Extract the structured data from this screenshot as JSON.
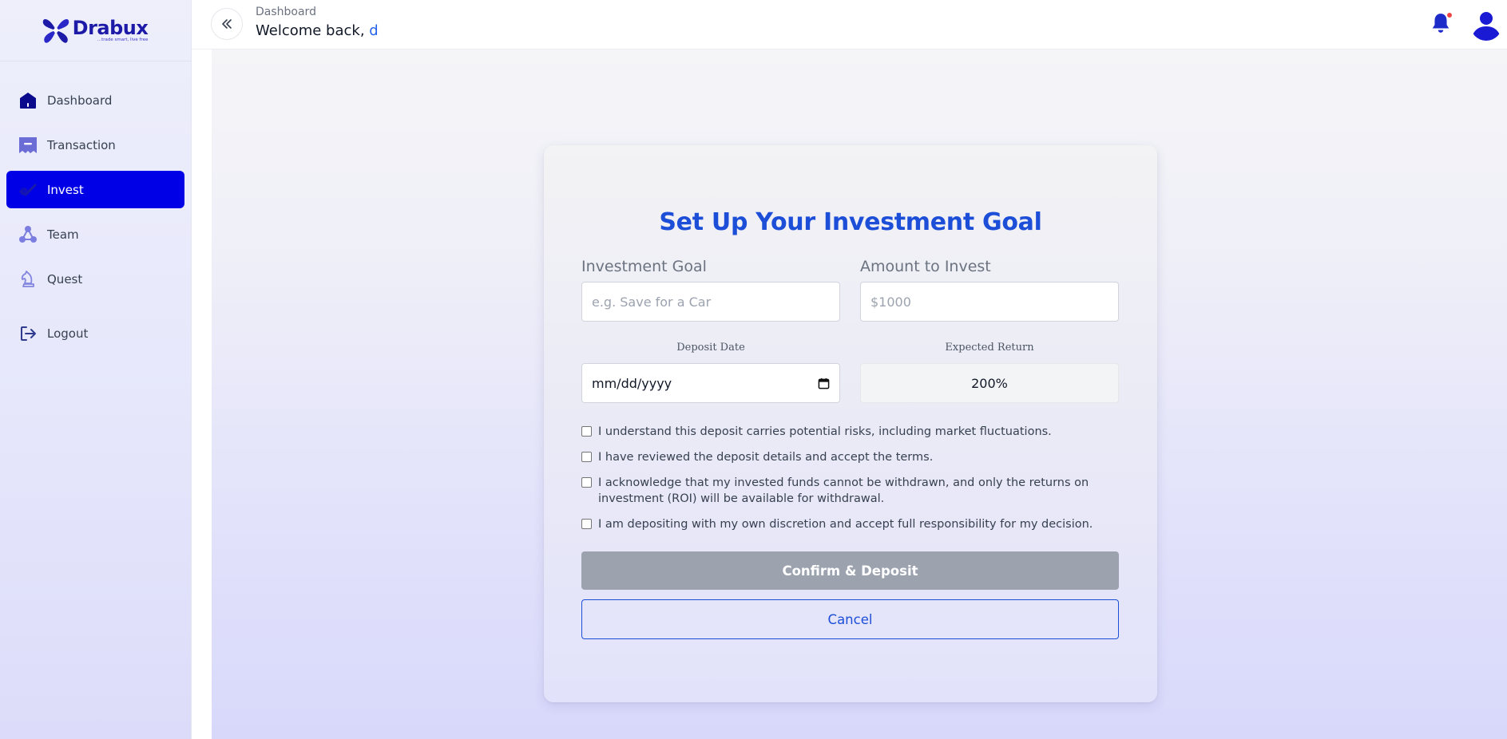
{
  "brand": {
    "name": "Drabux",
    "tagline": "...trade smart, live free",
    "color": "#1d1aa8"
  },
  "sidebar": {
    "items": [
      {
        "label": "Dashboard",
        "icon": "home-icon",
        "active": false
      },
      {
        "label": "Transaction",
        "icon": "receipt-icon",
        "active": false
      },
      {
        "label": "Invest",
        "icon": "chart-icon",
        "active": true
      },
      {
        "label": "Team",
        "icon": "team-nodes-icon",
        "active": false
      },
      {
        "label": "Quest",
        "icon": "chess-knight-icon",
        "active": false
      }
    ],
    "logout_label": "Logout",
    "active_color": "#0000e6"
  },
  "header": {
    "breadcrumb": "Dashboard",
    "welcome_prefix": "Welcome back,",
    "username": "d",
    "notification_icon": "bell-icon",
    "has_unread": true,
    "avatar_icon": "user-avatar-icon"
  },
  "form": {
    "title": "Set Up Your Investment Goal",
    "goal_label": "Investment Goal",
    "goal_placeholder": "e.g. Save for a Car",
    "goal_value": "",
    "amount_label": "Amount to Invest",
    "amount_placeholder": "$1000",
    "amount_value": "",
    "deposit_date_label": "Deposit Date",
    "deposit_date_placeholder": "mm/dd/yyyy",
    "expected_return_label": "Expected Return",
    "expected_return_value": "200%",
    "agreements": [
      {
        "text": "I understand this deposit carries potential risks, including market fluctuations.",
        "checked": false
      },
      {
        "text": "I have reviewed the deposit details and accept the terms.",
        "checked": false
      },
      {
        "text": "I acknowledge that my invested funds cannot be withdrawn, and only the returns on investment (ROI) will be available for withdrawal.",
        "checked": false
      },
      {
        "text": "I am depositing with my own discretion and accept full responsibility for my decision.",
        "checked": false
      }
    ],
    "confirm_label": "Confirm & Deposit",
    "confirm_enabled": false,
    "cancel_label": "Cancel",
    "accent_color": "#1d4ed8"
  }
}
